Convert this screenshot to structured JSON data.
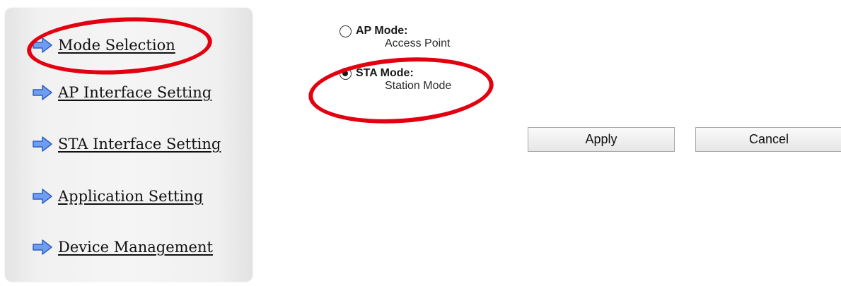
{
  "sidebar": {
    "items": [
      {
        "label": "Mode Selection",
        "icon": "arrow-right-icon"
      },
      {
        "label": "AP Interface Setting",
        "icon": "arrow-right-icon"
      },
      {
        "label": "STA Interface Setting",
        "icon": "arrow-right-icon"
      },
      {
        "label": "Application Setting",
        "icon": "arrow-right-icon"
      },
      {
        "label": "Device Management",
        "icon": "arrow-right-icon"
      }
    ]
  },
  "modes": [
    {
      "title": "AP Mode:",
      "description": "Access Point",
      "selected": false
    },
    {
      "title": "STA Mode:",
      "description": "Station Mode",
      "selected": true
    }
  ],
  "buttons": {
    "apply": "Apply",
    "cancel": "Cancel"
  },
  "colors": {
    "annotation": "#e3000f",
    "arrow_fill": "#6f9ef0",
    "arrow_stroke": "#2f5fc4"
  }
}
